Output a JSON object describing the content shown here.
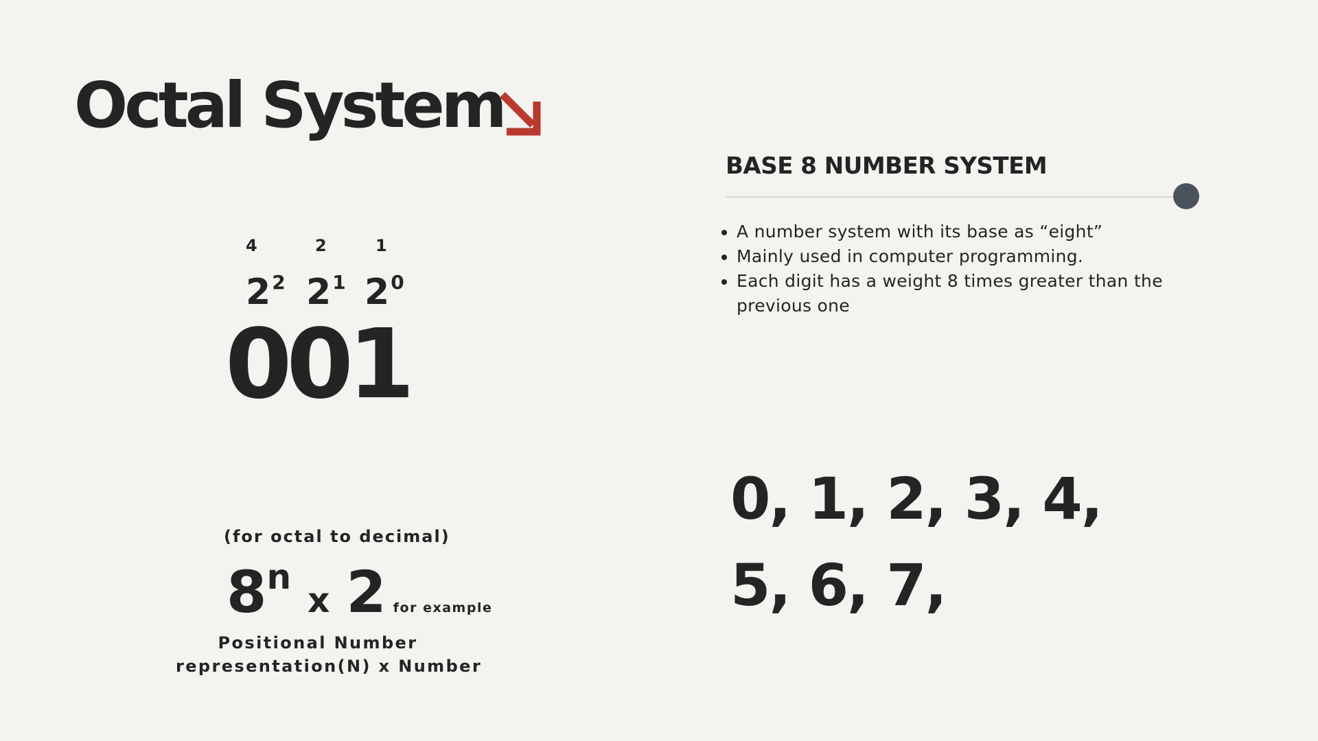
{
  "title": "Octal System",
  "accent_color": "#b83a2e",
  "arrow_icon": "arrow-down-right-icon",
  "heading": "BASE 8 NUMBER SYSTEM",
  "bullets": [
    "A number system with its base as “eight”",
    "Mainly used in computer programming.",
    "Each digit has a weight 8 times greater than the previous one"
  ],
  "positions": [
    {
      "weight": "4",
      "base": "2",
      "exponent": "2"
    },
    {
      "weight": "2",
      "base": "2",
      "exponent": "1"
    },
    {
      "weight": "1",
      "base": "2",
      "exponent": "0"
    }
  ],
  "number": "001",
  "formula": {
    "caption": "(for octal to decimal)",
    "base": "8",
    "exponent": "n",
    "operator": "x",
    "value": "2",
    "note": "for example",
    "description_line1": "Positional Number",
    "description_line2": "representation(N) x Number"
  },
  "digits_text": "0, 1, 2, 3, 4, 5, 6, 7,"
}
